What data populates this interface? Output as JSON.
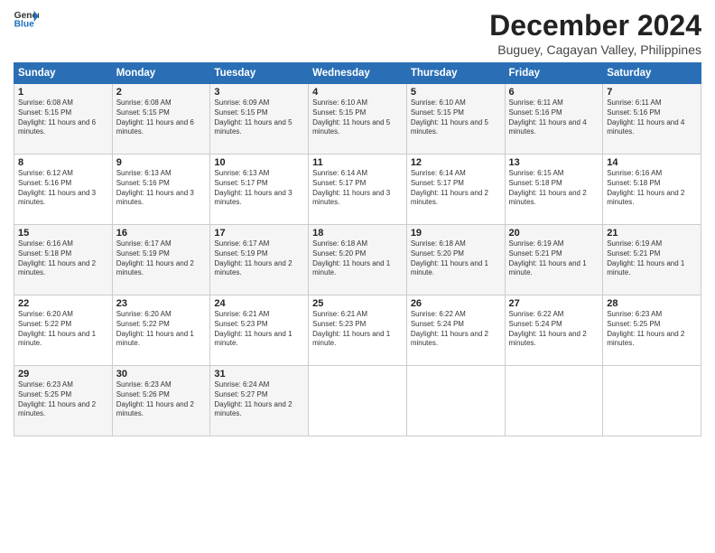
{
  "logo": {
    "line1": "General",
    "line2": "Blue"
  },
  "title": "December 2024",
  "subtitle": "Buguey, Cagayan Valley, Philippines",
  "days_of_week": [
    "Sunday",
    "Monday",
    "Tuesday",
    "Wednesday",
    "Thursday",
    "Friday",
    "Saturday"
  ],
  "weeks": [
    [
      {
        "num": "1",
        "sunrise": "Sunrise: 6:08 AM",
        "sunset": "Sunset: 5:15 PM",
        "daylight": "Daylight: 11 hours and 6 minutes."
      },
      {
        "num": "2",
        "sunrise": "Sunrise: 6:08 AM",
        "sunset": "Sunset: 5:15 PM",
        "daylight": "Daylight: 11 hours and 6 minutes."
      },
      {
        "num": "3",
        "sunrise": "Sunrise: 6:09 AM",
        "sunset": "Sunset: 5:15 PM",
        "daylight": "Daylight: 11 hours and 5 minutes."
      },
      {
        "num": "4",
        "sunrise": "Sunrise: 6:10 AM",
        "sunset": "Sunset: 5:15 PM",
        "daylight": "Daylight: 11 hours and 5 minutes."
      },
      {
        "num": "5",
        "sunrise": "Sunrise: 6:10 AM",
        "sunset": "Sunset: 5:15 PM",
        "daylight": "Daylight: 11 hours and 5 minutes."
      },
      {
        "num": "6",
        "sunrise": "Sunrise: 6:11 AM",
        "sunset": "Sunset: 5:16 PM",
        "daylight": "Daylight: 11 hours and 4 minutes."
      },
      {
        "num": "7",
        "sunrise": "Sunrise: 6:11 AM",
        "sunset": "Sunset: 5:16 PM",
        "daylight": "Daylight: 11 hours and 4 minutes."
      }
    ],
    [
      {
        "num": "8",
        "sunrise": "Sunrise: 6:12 AM",
        "sunset": "Sunset: 5:16 PM",
        "daylight": "Daylight: 11 hours and 3 minutes."
      },
      {
        "num": "9",
        "sunrise": "Sunrise: 6:13 AM",
        "sunset": "Sunset: 5:16 PM",
        "daylight": "Daylight: 11 hours and 3 minutes."
      },
      {
        "num": "10",
        "sunrise": "Sunrise: 6:13 AM",
        "sunset": "Sunset: 5:17 PM",
        "daylight": "Daylight: 11 hours and 3 minutes."
      },
      {
        "num": "11",
        "sunrise": "Sunrise: 6:14 AM",
        "sunset": "Sunset: 5:17 PM",
        "daylight": "Daylight: 11 hours and 3 minutes."
      },
      {
        "num": "12",
        "sunrise": "Sunrise: 6:14 AM",
        "sunset": "Sunset: 5:17 PM",
        "daylight": "Daylight: 11 hours and 2 minutes."
      },
      {
        "num": "13",
        "sunrise": "Sunrise: 6:15 AM",
        "sunset": "Sunset: 5:18 PM",
        "daylight": "Daylight: 11 hours and 2 minutes."
      },
      {
        "num": "14",
        "sunrise": "Sunrise: 6:16 AM",
        "sunset": "Sunset: 5:18 PM",
        "daylight": "Daylight: 11 hours and 2 minutes."
      }
    ],
    [
      {
        "num": "15",
        "sunrise": "Sunrise: 6:16 AM",
        "sunset": "Sunset: 5:18 PM",
        "daylight": "Daylight: 11 hours and 2 minutes."
      },
      {
        "num": "16",
        "sunrise": "Sunrise: 6:17 AM",
        "sunset": "Sunset: 5:19 PM",
        "daylight": "Daylight: 11 hours and 2 minutes."
      },
      {
        "num": "17",
        "sunrise": "Sunrise: 6:17 AM",
        "sunset": "Sunset: 5:19 PM",
        "daylight": "Daylight: 11 hours and 2 minutes."
      },
      {
        "num": "18",
        "sunrise": "Sunrise: 6:18 AM",
        "sunset": "Sunset: 5:20 PM",
        "daylight": "Daylight: 11 hours and 1 minute."
      },
      {
        "num": "19",
        "sunrise": "Sunrise: 6:18 AM",
        "sunset": "Sunset: 5:20 PM",
        "daylight": "Daylight: 11 hours and 1 minute."
      },
      {
        "num": "20",
        "sunrise": "Sunrise: 6:19 AM",
        "sunset": "Sunset: 5:21 PM",
        "daylight": "Daylight: 11 hours and 1 minute."
      },
      {
        "num": "21",
        "sunrise": "Sunrise: 6:19 AM",
        "sunset": "Sunset: 5:21 PM",
        "daylight": "Daylight: 11 hours and 1 minute."
      }
    ],
    [
      {
        "num": "22",
        "sunrise": "Sunrise: 6:20 AM",
        "sunset": "Sunset: 5:22 PM",
        "daylight": "Daylight: 11 hours and 1 minute."
      },
      {
        "num": "23",
        "sunrise": "Sunrise: 6:20 AM",
        "sunset": "Sunset: 5:22 PM",
        "daylight": "Daylight: 11 hours and 1 minute."
      },
      {
        "num": "24",
        "sunrise": "Sunrise: 6:21 AM",
        "sunset": "Sunset: 5:23 PM",
        "daylight": "Daylight: 11 hours and 1 minute."
      },
      {
        "num": "25",
        "sunrise": "Sunrise: 6:21 AM",
        "sunset": "Sunset: 5:23 PM",
        "daylight": "Daylight: 11 hours and 1 minute."
      },
      {
        "num": "26",
        "sunrise": "Sunrise: 6:22 AM",
        "sunset": "Sunset: 5:24 PM",
        "daylight": "Daylight: 11 hours and 2 minutes."
      },
      {
        "num": "27",
        "sunrise": "Sunrise: 6:22 AM",
        "sunset": "Sunset: 5:24 PM",
        "daylight": "Daylight: 11 hours and 2 minutes."
      },
      {
        "num": "28",
        "sunrise": "Sunrise: 6:23 AM",
        "sunset": "Sunset: 5:25 PM",
        "daylight": "Daylight: 11 hours and 2 minutes."
      }
    ],
    [
      {
        "num": "29",
        "sunrise": "Sunrise: 6:23 AM",
        "sunset": "Sunset: 5:25 PM",
        "daylight": "Daylight: 11 hours and 2 minutes."
      },
      {
        "num": "30",
        "sunrise": "Sunrise: 6:23 AM",
        "sunset": "Sunset: 5:26 PM",
        "daylight": "Daylight: 11 hours and 2 minutes."
      },
      {
        "num": "31",
        "sunrise": "Sunrise: 6:24 AM",
        "sunset": "Sunset: 5:27 PM",
        "daylight": "Daylight: 11 hours and 2 minutes."
      },
      null,
      null,
      null,
      null
    ]
  ]
}
